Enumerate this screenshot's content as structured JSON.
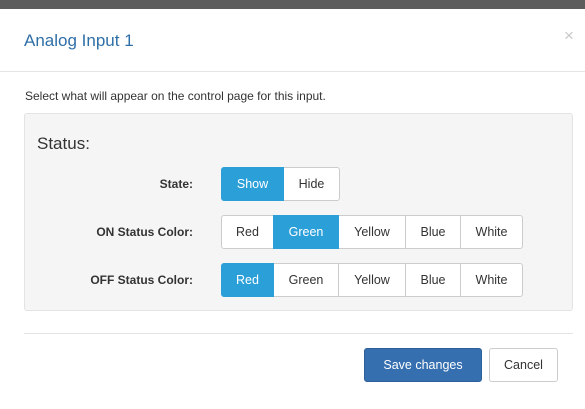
{
  "dialog": {
    "title": "Analog Input 1",
    "close_glyph": "×",
    "description": "Select what will appear on the control page for this input."
  },
  "status_panel": {
    "title": "Status:",
    "rows": [
      {
        "label": "State:",
        "options": [
          "Show",
          "Hide"
        ],
        "selected": "Show"
      },
      {
        "label": "ON Status Color:",
        "options": [
          "Red",
          "Green",
          "Yellow",
          "Blue",
          "White"
        ],
        "selected": "Green"
      },
      {
        "label": "OFF Status Color:",
        "options": [
          "Red",
          "Green",
          "Yellow",
          "Blue",
          "White"
        ],
        "selected": "Red"
      }
    ]
  },
  "footer": {
    "save_label": "Save changes",
    "cancel_label": "Cancel"
  },
  "colors": {
    "accent": "#2b9fd8",
    "primary_button": "#356fb0",
    "title_text": "#2f6fa7"
  }
}
